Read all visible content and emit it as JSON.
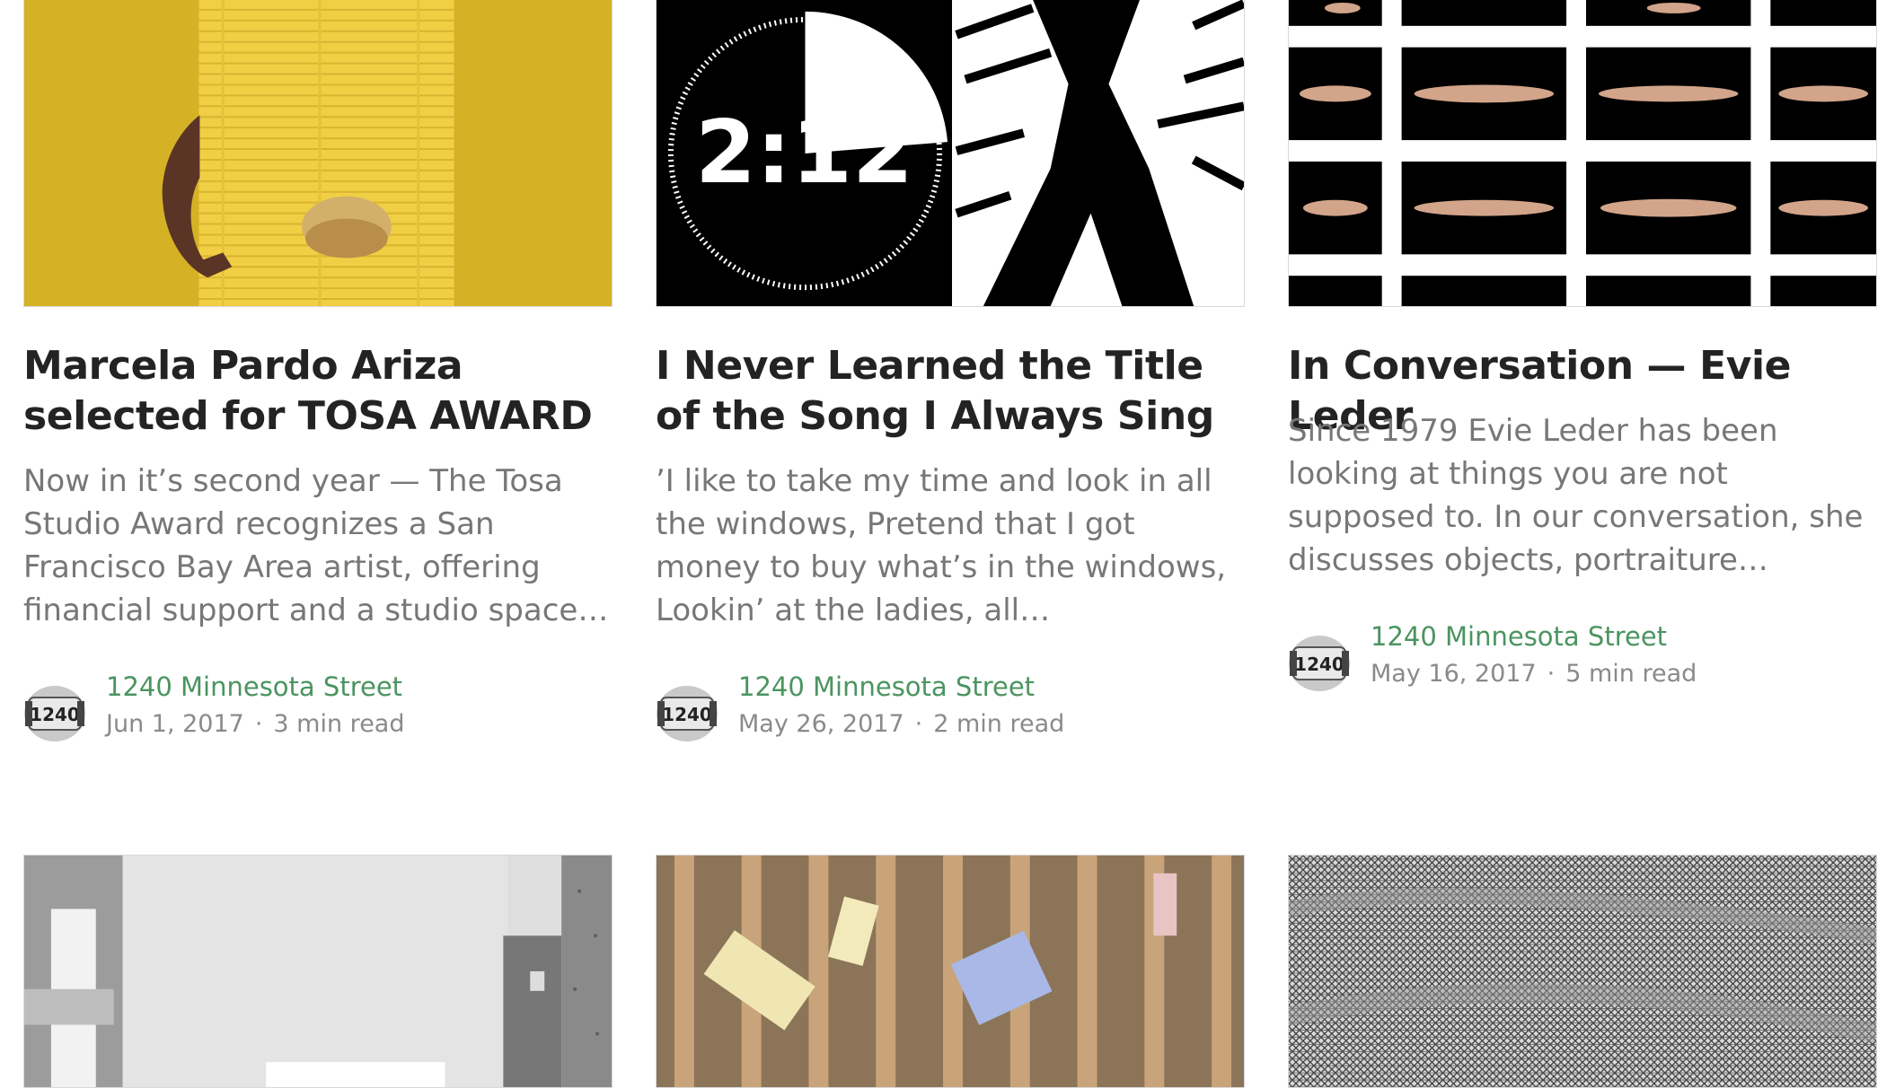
{
  "posts": [
    {
      "title": "Marcela Pardo Ariza selected for TOSA AWARD",
      "excerpt": "Now in it’s second year — The Tosa Studio Award recognizes a San Francisco Bay Area artist, offering financial support and a studio space…",
      "author": "1240 Minnesota Street",
      "date": "Jun 1, 2017",
      "read_time": "3 min read",
      "avatar_text": "1240"
    },
    {
      "title": "I Never Learned the Title of the Song I Always Sing",
      "excerpt": "’I like to take my time and look in all the windows, Pretend that I got money to buy what’s in the windows, Lookin’ at the ladies, all…",
      "author": "1240 Minnesota Street",
      "date": "May 26, 2017",
      "read_time": "2 min read",
      "avatar_text": "1240",
      "image_text": "2:12"
    },
    {
      "title": "In Conversation — Evie Leder",
      "excerpt": "Since 1979 Evie Leder has been looking at things you are not supposed to. In our conversation, she discusses objects, portraiture…",
      "author": "1240 Minnesota Street",
      "date": "May 16, 2017",
      "read_time": "5 min read",
      "avatar_text": "1240"
    }
  ],
  "meta_separator": "·",
  "colors": {
    "title": "#232323",
    "excerpt": "#777777",
    "author_link": "#4b9460",
    "meta": "#8a8a8a"
  }
}
